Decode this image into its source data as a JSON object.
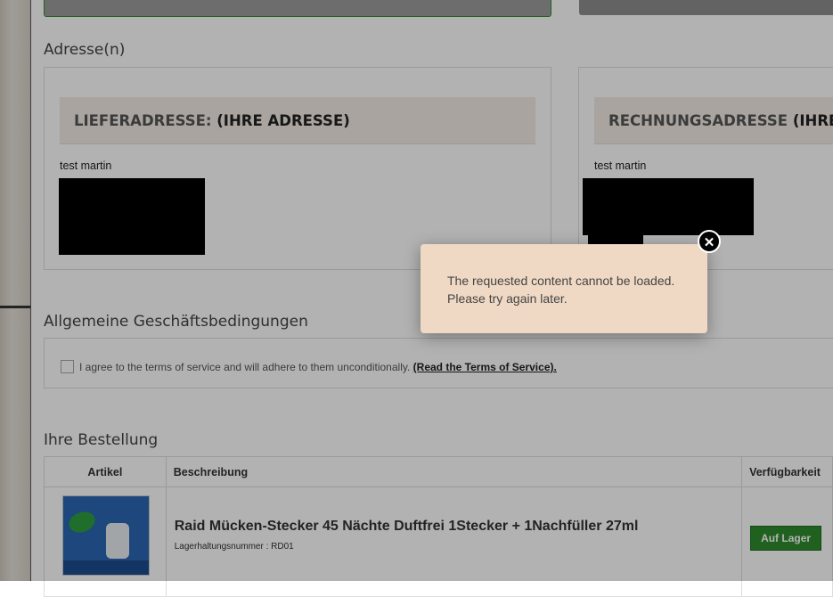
{
  "sections": {
    "addresses": "Adresse(n)",
    "terms": "Allgemeine Geschäftsbedingungen",
    "order": "Ihre Bestellung"
  },
  "shipping": {
    "label": "LIEFERADRESSE:",
    "suffix": "(IHRE ADRESSE)",
    "name": "test martin"
  },
  "billing": {
    "label": "RECHNUNGSADRESSE",
    "suffix": "(IHRE A",
    "name": "test martin"
  },
  "terms": {
    "text": "I agree to the terms of service and will adhere to them unconditionally.",
    "link": "(Read the Terms of Service)."
  },
  "order_table": {
    "headers": [
      "Artikel",
      "Beschreibung",
      "Verfügbarkeit"
    ],
    "rows": [
      {
        "title": "Raid Mücken-Stecker 45 Nächte Duftfrei 1Stecker + 1Nachfüller 27ml",
        "sku": "Lagerhaltungsnummer : RD01",
        "availability": "Auf Lager"
      }
    ]
  },
  "modal": {
    "message_line1": "The requested content cannot be loaded.",
    "message_line2": "Please try again later.",
    "close_icon": "close-icon"
  },
  "colors": {
    "modal_bg": "#f0d9c4",
    "badge_green": "#2e8b2e",
    "overlay": "rgba(0,0,0,0.30)"
  }
}
